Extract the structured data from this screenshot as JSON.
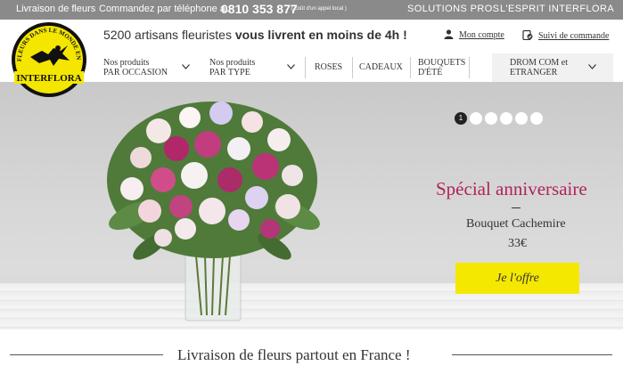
{
  "topbar": {
    "delivery": "Livraison de fleurs",
    "phone_label": "Commandez par téléphone au",
    "phone": "0810 353 877",
    "phone_note": "( coût d'un appel local )",
    "pros": "SOLUTIONS PROS",
    "esprit": "L'ESPRIT INTERFLORA"
  },
  "header": {
    "tagline_start": "5200 artisans fleuristes ",
    "tagline_bold": "vous livrent en moins de 4h !",
    "account": "Mon compte",
    "track": "Suivi de commande",
    "logo_text": "INTERFLORA",
    "logo_arc": "DES FLEURS DANS LE MONDE ENTIER"
  },
  "nav": {
    "occasion_line1": "Nos produits",
    "occasion_line2": "PAR OCCASION",
    "type_line1": "Nos produits",
    "type_line2": "PAR TYPE",
    "roses": "ROSES",
    "cadeaux": "CADEAUX",
    "bouquets_line1": "BOUQUETS",
    "bouquets_line2": "D'ÉTÉ",
    "drom_line1": "DROM COM et",
    "drom_line2": "ETRANGER"
  },
  "hero": {
    "active_slide": "1",
    "slide_count": 6,
    "title": "Spécial anniversaire",
    "product": "Bouquet Cachemire",
    "price": "33€",
    "cta": "Je l'offre"
  },
  "bottom": {
    "title": "Livraison de fleurs partout en France !"
  },
  "colors": {
    "topbar": "#8a8a8a",
    "accent": "#b0245c",
    "cta": "#f5e800",
    "logo_yellow": "#f5e600"
  }
}
